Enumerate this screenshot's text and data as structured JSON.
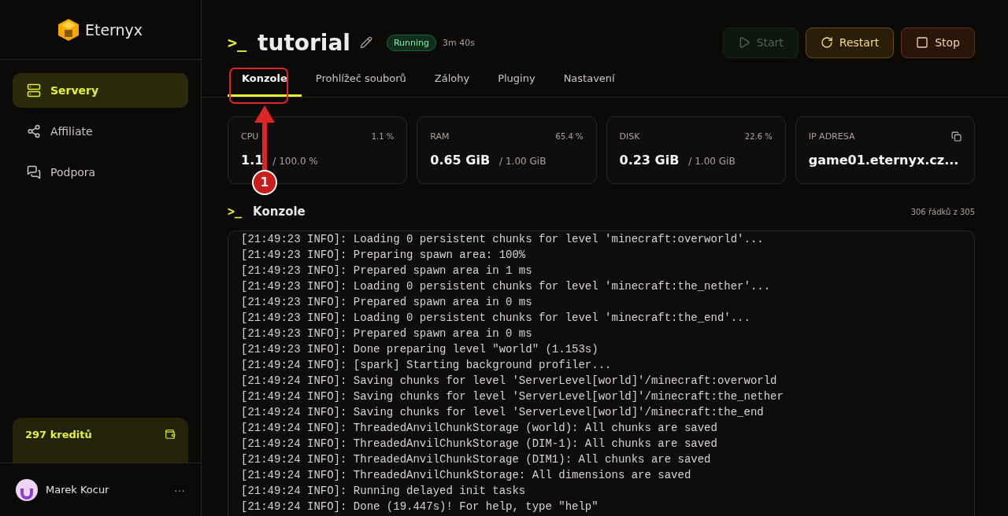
{
  "brand": {
    "name": "Eternyx"
  },
  "nav": [
    {
      "label": "Servery",
      "selected": true
    },
    {
      "label": "Affiliate",
      "selected": false
    },
    {
      "label": "Podpora",
      "selected": false
    }
  ],
  "credits": {
    "label": "297 kreditů"
  },
  "user": {
    "name": "Marek Kocur",
    "menu": "···"
  },
  "server": {
    "prompt": ">_",
    "name": "tutorial",
    "status": "Running",
    "uptime": "3m 40s"
  },
  "actions": [
    {
      "label": "Start",
      "kind": "start",
      "disabled": true
    },
    {
      "label": "Restart",
      "kind": "restart",
      "disabled": false
    },
    {
      "label": "Stop",
      "kind": "stop",
      "disabled": false
    }
  ],
  "tabs": [
    {
      "label": "Konzole",
      "selected": true
    },
    {
      "label": "Prohlížeč souborů",
      "selected": false
    },
    {
      "label": "Zálohy",
      "selected": false
    },
    {
      "label": "Pluginy",
      "selected": false
    },
    {
      "label": "Nastavení",
      "selected": false
    }
  ],
  "stats": [
    {
      "kind": "usage",
      "label": "CPU",
      "percent": "1.1 %",
      "value": "1.1",
      "total": "/ 100.0 %"
    },
    {
      "kind": "usage",
      "label": "RAM",
      "percent": "65.4 %",
      "value": "0.65 GiB",
      "total": "/ 1.00 GiB"
    },
    {
      "kind": "usage",
      "label": "DISK",
      "percent": "22.6 %",
      "value": "0.23 GiB",
      "total": "/ 1.00 GiB"
    },
    {
      "kind": "address",
      "label": "IP ADRESA",
      "value": "game01.eternyx.cz..."
    }
  ],
  "console": {
    "prompt": ">_",
    "title": "Konzole",
    "count": "306 řádků z 305",
    "lines": [
      "[21:49:23 INFO]: Loading 0 persistent chunks for level 'minecraft:overworld'...",
      "[21:49:23 INFO]: Preparing spawn area: 100%",
      "[21:49:23 INFO]: Prepared spawn area in 1 ms",
      "[21:49:23 INFO]: Loading 0 persistent chunks for level 'minecraft:the_nether'...",
      "[21:49:23 INFO]: Prepared spawn area in 0 ms",
      "[21:49:23 INFO]: Loading 0 persistent chunks for level 'minecraft:the_end'...",
      "[21:49:23 INFO]: Prepared spawn area in 0 ms",
      "[21:49:23 INFO]: Done preparing level \"world\" (1.153s)",
      "[21:49:24 INFO]: [spark] Starting background profiler...",
      "[21:49:24 INFO]: Saving chunks for level 'ServerLevel[world]'/minecraft:overworld",
      "[21:49:24 INFO]: Saving chunks for level 'ServerLevel[world]'/minecraft:the_nether",
      "[21:49:24 INFO]: Saving chunks for level 'ServerLevel[world]'/minecraft:the_end",
      "[21:49:24 INFO]: ThreadedAnvilChunkStorage (world): All chunks are saved",
      "[21:49:24 INFO]: ThreadedAnvilChunkStorage (DIM-1): All chunks are saved",
      "[21:49:24 INFO]: ThreadedAnvilChunkStorage (DIM1): All chunks are saved",
      "[21:49:24 INFO]: ThreadedAnvilChunkStorage: All dimensions are saved",
      "[21:49:24 INFO]: Running delayed init tasks",
      "[21:49:24 INFO]: Done (19.447s)! For help, type \"help\""
    ]
  },
  "annotation": {
    "number": "1"
  }
}
